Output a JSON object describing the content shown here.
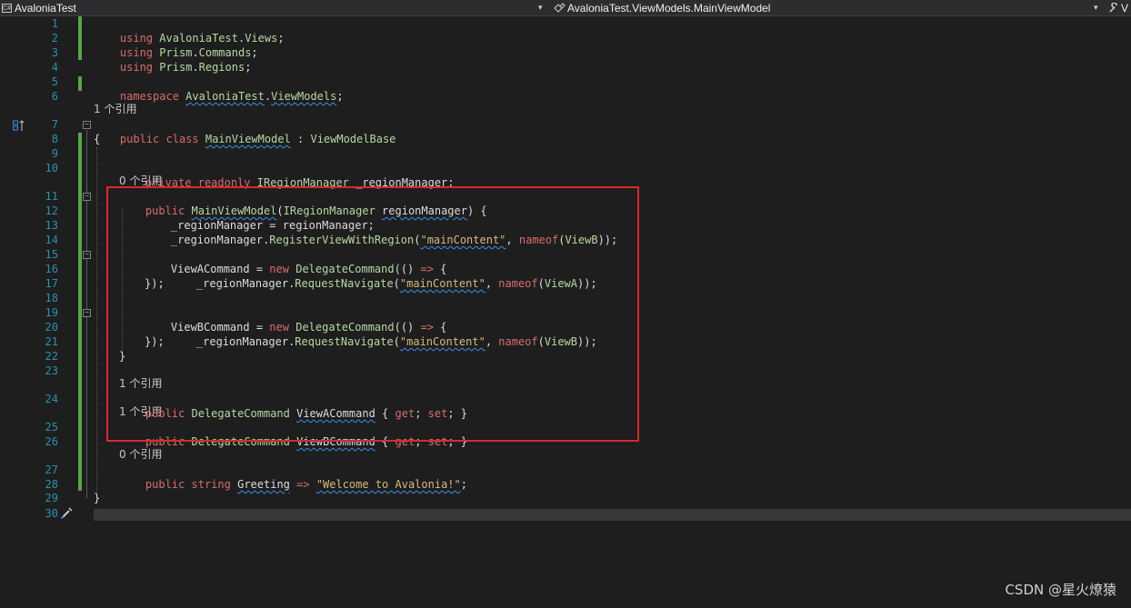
{
  "navbar": {
    "project": "AvaloniaTest",
    "type_path": "AvaloniaTest.ViewModels.MainViewModel",
    "member": "V",
    "project_icon_label": "C#"
  },
  "lens": {
    "l7": "1 个引用",
    "l11": "0 个引用",
    "l24": "1 个引用",
    "l25": "1 个引用",
    "l27": "0 个引用"
  },
  "code": {
    "l1": [
      "using",
      " ",
      "AvaloniaTest",
      ".",
      "Views",
      ";"
    ],
    "l2": [
      "using",
      " ",
      "Prism",
      ".",
      "Commands",
      ";"
    ],
    "l3": [
      "using",
      " ",
      "Prism",
      ".",
      "Regions",
      ";"
    ],
    "l5": [
      "namespace",
      " ",
      "AvaloniaTest",
      ".",
      "ViewModels",
      ";"
    ],
    "l7": [
      "public",
      " ",
      "class",
      " ",
      "MainViewModel",
      " : ",
      "ViewModelBase"
    ],
    "l8": "{",
    "l10": [
      "private",
      " ",
      "readonly",
      " ",
      "IRegionManager",
      " _regionManager;"
    ],
    "l11": [
      "public",
      " ",
      "MainViewModel",
      "(",
      "IRegionManager",
      " ",
      "regionManager",
      ") {"
    ],
    "l12": [
      "_regionManager",
      " = ",
      "regionManager",
      ";"
    ],
    "l13": [
      "_regionManager",
      ".",
      "RegisterViewWithRegion",
      "(",
      "\"mainContent\"",
      ", ",
      "nameof",
      "(",
      "ViewB",
      "));"
    ],
    "l15": [
      "ViewACommand",
      " = ",
      "new",
      " ",
      "DelegateCommand",
      "(() ",
      "=>",
      " {"
    ],
    "l16": [
      "_regionManager",
      ".",
      "RequestNavigate",
      "(",
      "\"mainContent\"",
      ", ",
      "nameof",
      "(",
      "ViewA",
      "));"
    ],
    "l17": "});",
    "l19": [
      "ViewBCommand",
      " = ",
      "new",
      " ",
      "DelegateCommand",
      "(() ",
      "=>",
      " {"
    ],
    "l20": [
      "_regionManager",
      ".",
      "RequestNavigate",
      "(",
      "\"mainContent\"",
      ", ",
      "nameof",
      "(",
      "ViewB",
      "));"
    ],
    "l21": "});",
    "l22": "}",
    "l24": [
      "public",
      " ",
      "DelegateCommand",
      " ",
      "ViewACommand",
      " { ",
      "get",
      "; ",
      "set",
      "; }"
    ],
    "l25": [
      "public",
      " ",
      "DelegateCommand",
      " ",
      "ViewBCommand",
      " { ",
      "get",
      "; ",
      "set",
      "; }"
    ],
    "l27": [
      "public",
      " ",
      "string",
      " ",
      "Greeting",
      " ",
      "=>",
      " ",
      "\"Welcome to Avalonia!\"",
      ";"
    ],
    "l29": "}"
  },
  "line_numbers": [
    "1",
    "2",
    "3",
    "4",
    "5",
    "6",
    "7",
    "8",
    "9",
    "10",
    "11",
    "12",
    "13",
    "14",
    "15",
    "16",
    "17",
    "18",
    "19",
    "20",
    "21",
    "22",
    "23",
    "24",
    "25",
    "26",
    "27",
    "28",
    "29",
    "30"
  ],
  "watermark": "CSDN @星火燎猿",
  "colors": {
    "background": "#1e1e1e",
    "line_number": "#2b91af",
    "keyword": "#d86c6c",
    "type": "#b8d7a3",
    "string": "#ce9178",
    "change_bar": "#57a64a",
    "annotation_box": "#d42c2c"
  },
  "icons": [
    "csharp-project-icon",
    "class-icon",
    "wrench-icon",
    "bookmark-icon",
    "quick-actions-brush-icon"
  ]
}
